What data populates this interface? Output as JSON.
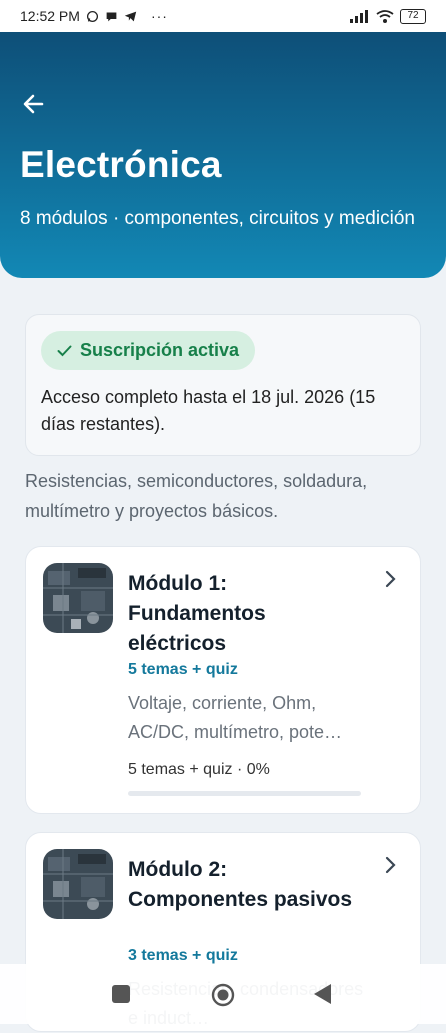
{
  "status_bar": {
    "time": "12:52 PM",
    "battery": "72",
    "more": "···",
    "icons": [
      "whatsapp-icon",
      "chat-icon",
      "telegram-icon",
      "signal-icon",
      "wifi-icon",
      "battery-icon"
    ]
  },
  "header": {
    "title": "Electrónica",
    "subtitle": "8 módulos · componentes, circuitos y medición",
    "gradient": [
      "#0e4f78",
      "#1288b5"
    ]
  },
  "subscription": {
    "badge_label": "Suscripción activa",
    "access_text": "Acceso completo hasta el 18 jul. 2026 (15 días restantes).",
    "badge_bg": "#d6efe1",
    "badge_color": "#17804a"
  },
  "course_description": "Resistencias, semiconductores, soldadura, multímetro y proyectos básicos.",
  "modules": [
    {
      "title": "Módulo 1: Fundamentos eléctricos",
      "topics": "5 temas + quiz",
      "summary": "Voltaje, corriente, Ohm, AC/DC, multímetro, pote…",
      "progress_text": "5 temas + quiz · 0%",
      "progress": 0
    },
    {
      "title": "Módulo 2: Componentes pasivos",
      "topics": "3 temas + quiz",
      "summary": "Resistencias, condensadores e induct…"
    }
  ],
  "colors": {
    "accent": "#1288b5",
    "topics": "#14799c"
  }
}
